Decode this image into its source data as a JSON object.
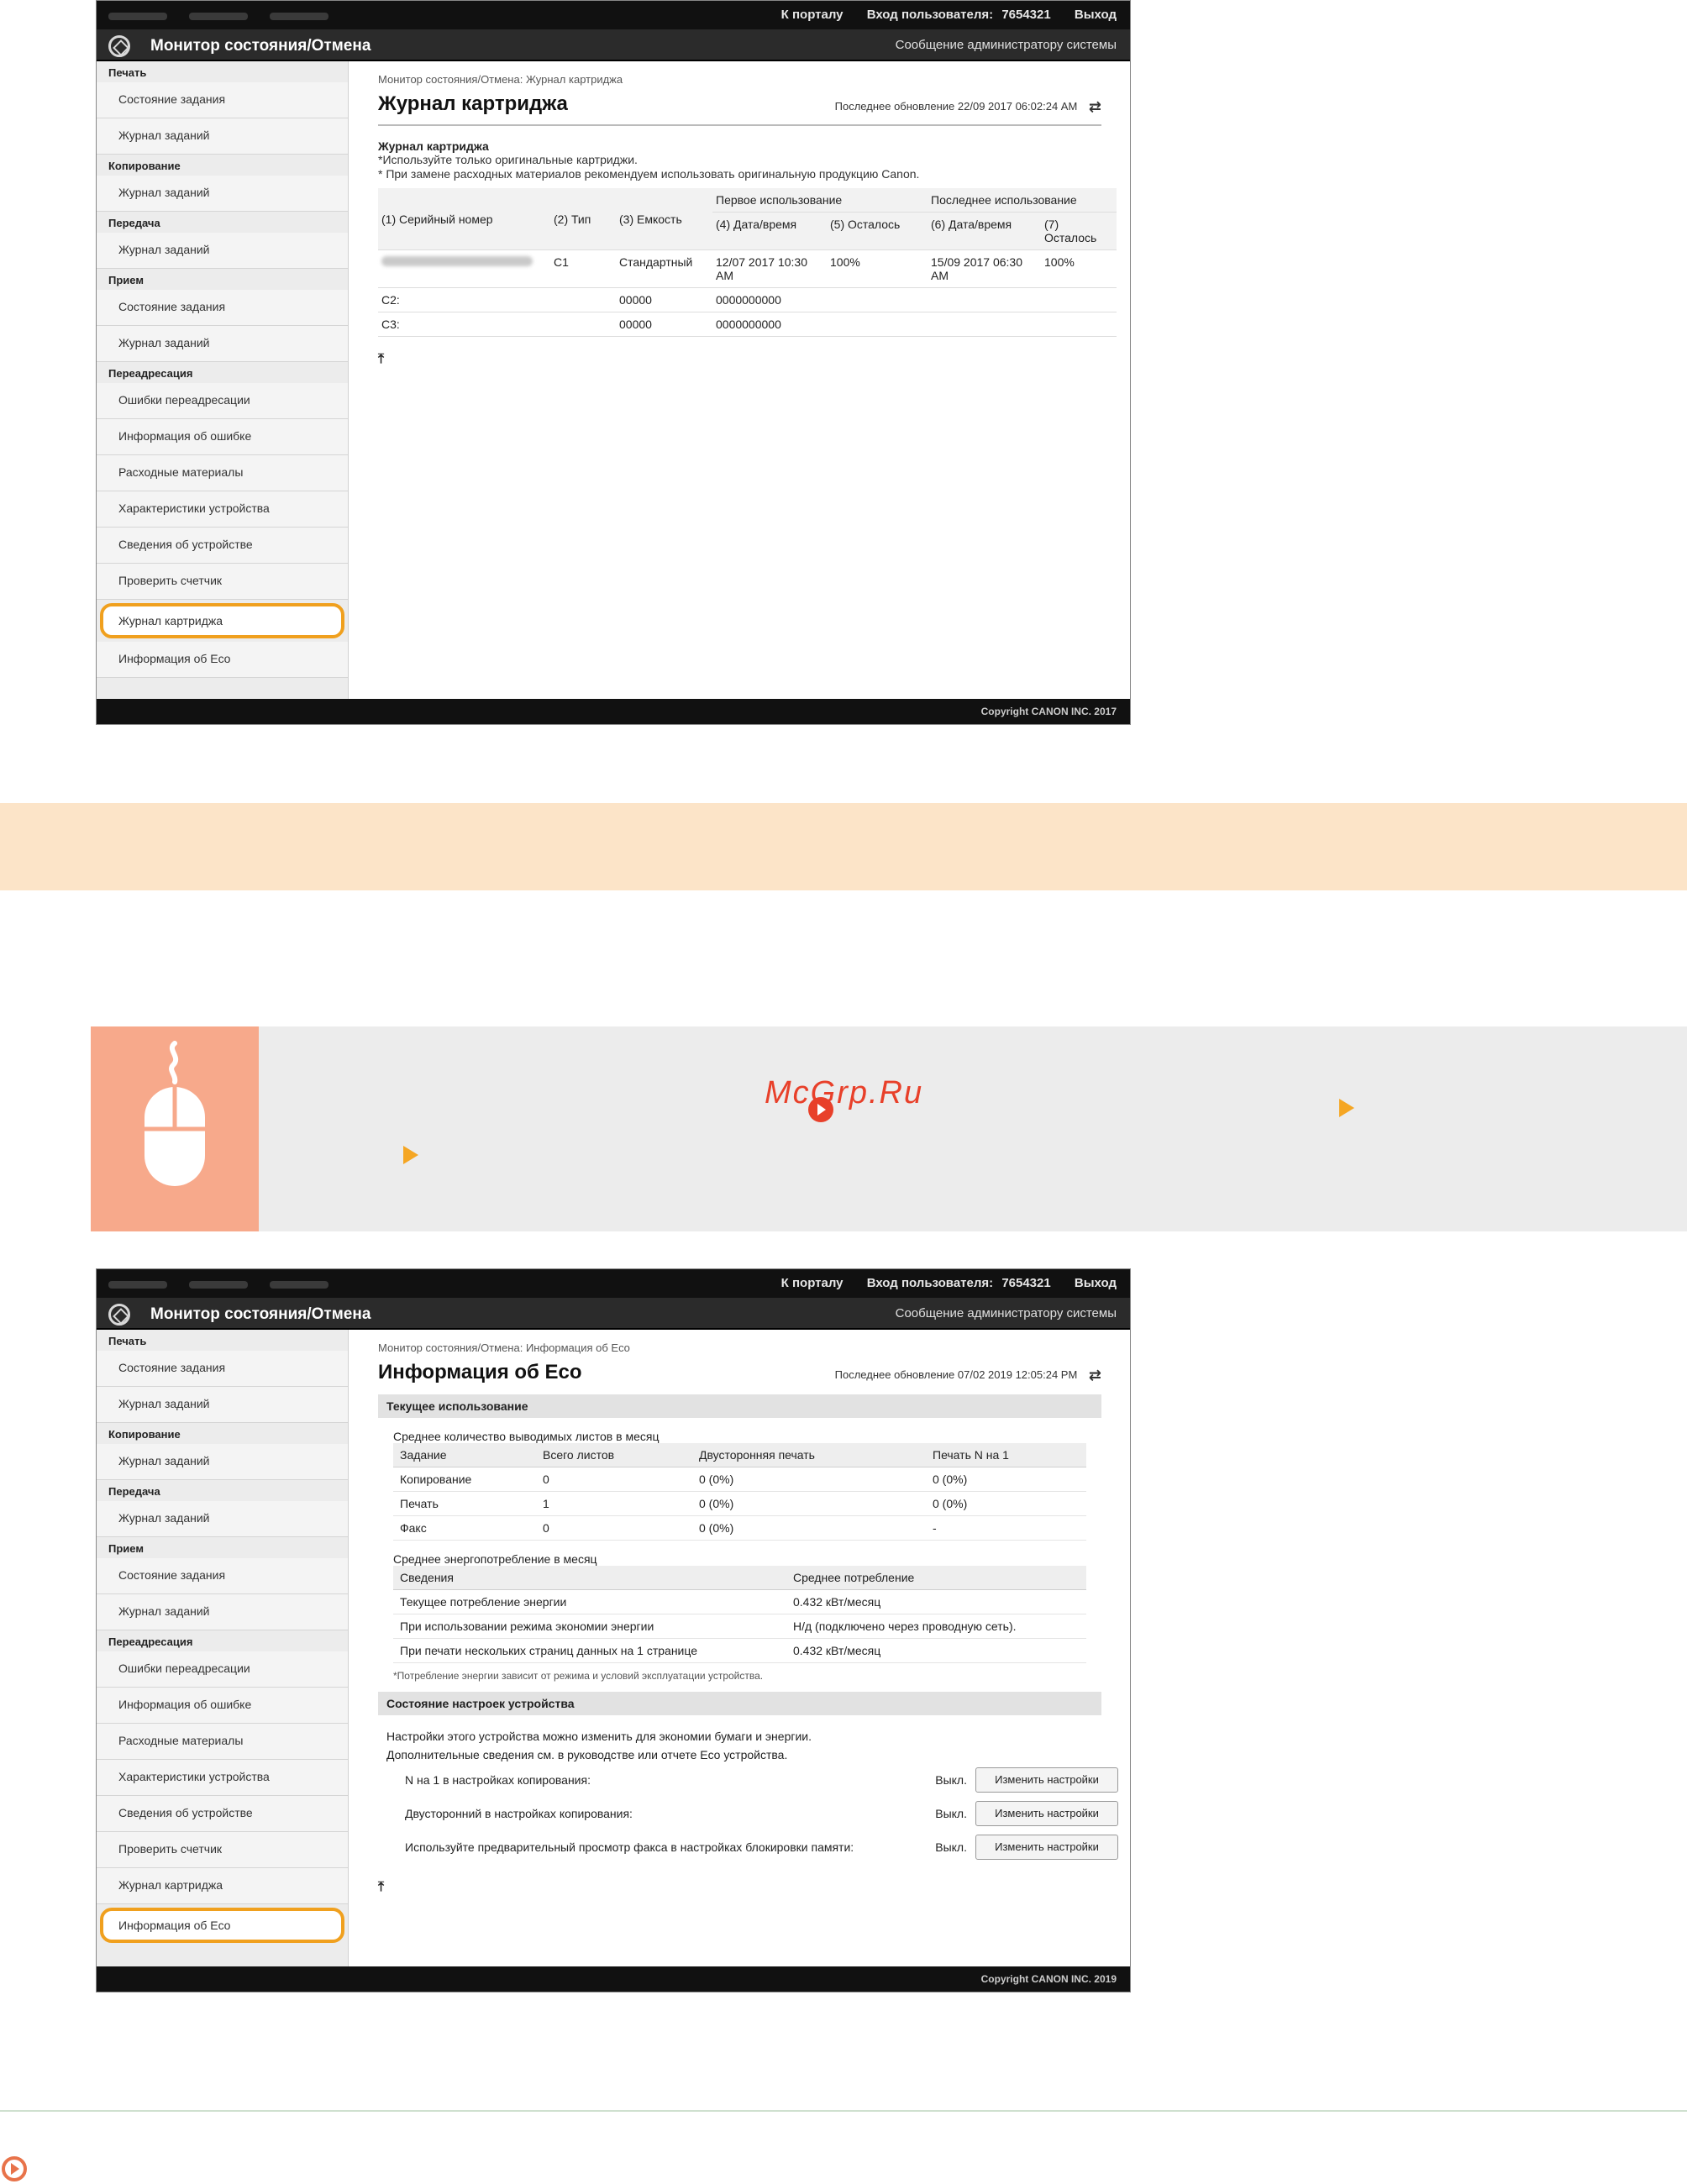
{
  "common": {
    "portal": "К порталу",
    "login_label": "Вход пользователя:",
    "user_id": "7654321",
    "logout": "Выход",
    "app_title": "Монитор состояния/Отмена",
    "admin_msg": "Сообщение администратору системы",
    "last_update_label": "Последнее обновление",
    "refresh_icon": "refresh-icon"
  },
  "sidebar": {
    "print": "Печать",
    "copy": "Копирование",
    "send": "Передача",
    "receive": "Прием",
    "forward": "Переадресация",
    "job_status": "Состояние задания",
    "job_log": "Журнал заданий",
    "forward_errors": "Ошибки переадресации",
    "error_info": "Информация об ошибке",
    "consumables": "Расходные материалы",
    "device_features": "Характеристики устройства",
    "device_info": "Сведения об устройстве",
    "check_counter": "Проверить счетчик",
    "cartridge_log": "Журнал картриджа",
    "eco_info": "Информация об Eco"
  },
  "shot1": {
    "breadcrumb": "Монитор состояния/Отмена: Журнал картриджа",
    "title": "Журнал картриджа",
    "updated": "22/09 2017 06:02:24 AM",
    "section": "Журнал картриджа",
    "note1": "*Используйте только оригинальные картриджи.",
    "note2": "* При замене расходных материалов рекомендуем использовать оригинальную продукцию Canon.",
    "first_use": "Первое использование",
    "last_use": "Последнее использование",
    "h_serial": "(1) Серийный номер",
    "h_type": "(2) Тип",
    "h_capacity": "(3) Емкость",
    "h_date4": "(4) Дата/время",
    "h_left5": "(5) Осталось",
    "h_date6": "(6) Дата/время",
    "h_left7": "(7) Осталось",
    "row1": {
      "type": "C1",
      "capacity": "Стандартный",
      "date1": "12/07 2017 10:30 AM",
      "left1": "100%",
      "date2": "15/09 2017 06:30 AM",
      "left2": "100%"
    },
    "row2": {
      "label": "C2:",
      "capacity": "00000",
      "date": "0000000000"
    },
    "row3": {
      "label": "C3:",
      "capacity": "00000",
      "date": "0000000000"
    },
    "copyright": "Copyright CANON INC. 2017"
  },
  "shot2": {
    "breadcrumb": "Монитор состояния/Отмена: Информация об Eco",
    "title": "Информация об Eco",
    "updated": "07/02 2019 12:05:24 PM",
    "current_usage": "Текущее использование",
    "avg_sheets": "Среднее количество выводимых листов в месяц",
    "t1": {
      "headers": [
        "Задание",
        "Всего листов",
        "Двусторонняя печать",
        "Печать N на 1"
      ],
      "rows": [
        [
          "Копирование",
          "0",
          "0 (0%)",
          "0 (0%)"
        ],
        [
          "Печать",
          "1",
          "0 (0%)",
          "0 (0%)"
        ],
        [
          "Факс",
          "0",
          "0 (0%)",
          "-"
        ]
      ]
    },
    "avg_energy": "Среднее энергопотребление в месяц",
    "t2": {
      "headers": [
        "Сведения",
        "Среднее потребление"
      ],
      "rows": [
        [
          "Текущее потребление энергии",
          "0.432 кВт/месяц"
        ],
        [
          "При использовании режима экономии энергии",
          "Н/д (подключено через проводную сеть)."
        ],
        [
          "При печати нескольких страниц данных на 1 странице",
          "0.432 кВт/месяц"
        ]
      ]
    },
    "energy_note": "*Потребление энергии зависит от режима и условий эксплуатации устройства.",
    "device_settings": "Состояние настроек устройства",
    "para1": "Настройки этого устройства можно изменить для экономии бумаги и энергии.",
    "para2": "Дополнительные сведения см. в руководстве или отчете Eco устройства.",
    "settings": [
      {
        "label": "N на 1 в настройках копирования:",
        "value": "Выкл.",
        "button": "Изменить настройки"
      },
      {
        "label": "Двусторонний в настройках копирования:",
        "value": "Выкл.",
        "button": "Изменить настройки"
      },
      {
        "label": "Используйте предварительный просмотр факса в настройках блокировки памяти:",
        "value": "Выкл.",
        "button": "Изменить настройки"
      }
    ],
    "copyright": "Copyright CANON INC. 2019"
  },
  "watermark": "McGrp.Ru",
  "colors": {
    "accent": "#f5a623",
    "highlight": "#f0a01e",
    "tip_band": "#fce4c8",
    "icon_bg": "#f7a98b"
  }
}
